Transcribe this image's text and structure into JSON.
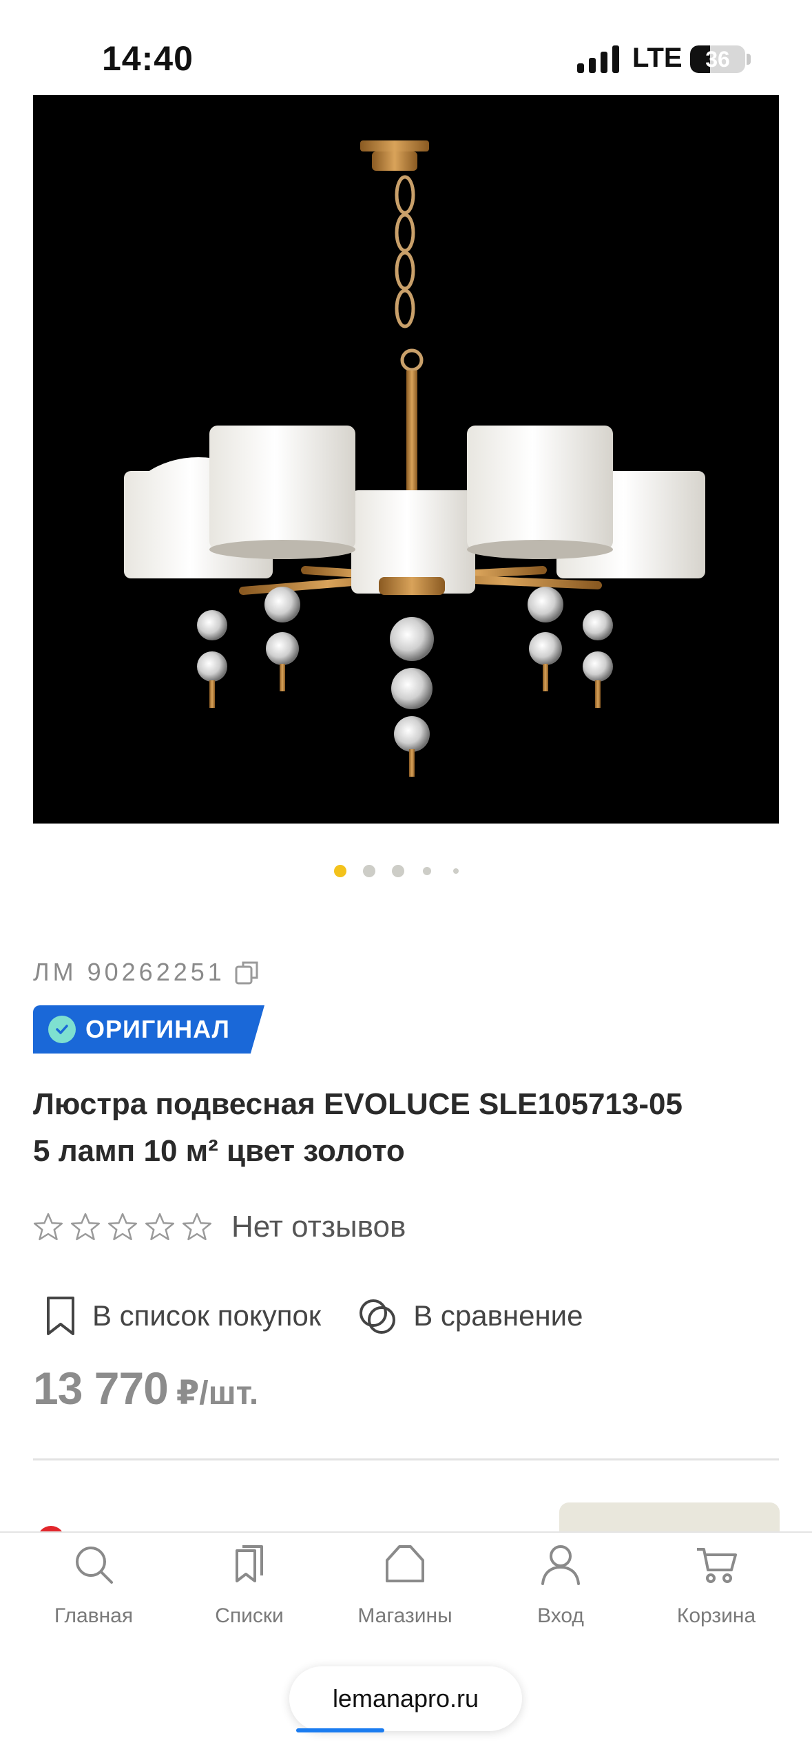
{
  "status_bar": {
    "time": "14:40",
    "network": "LTE",
    "battery": "36",
    "battery_level": 0.36
  },
  "gallery": {
    "image_alt": "Люстра подвесная EVOLUCE SLE105713-05",
    "slide_count": 5,
    "active_slide": 1,
    "active_color": "#f3c21b"
  },
  "product": {
    "sku": "ЛМ 90262251",
    "badge": "ОРИГИНАЛ",
    "title_line1": "Люстра подвесная EVOLUCE SLE105713-05",
    "title_line2": "5 ламп 10 м² цвет золото",
    "rating_stars": 0,
    "reviews": "Нет отзывов",
    "add_to_list": "В список покупок",
    "compare": "В сравнение",
    "price": "13 770",
    "price_unit": "₽/шт."
  },
  "tabbar": {
    "items": [
      {
        "label": "Главная",
        "icon": "search-icon"
      },
      {
        "label": "Списки",
        "icon": "lists-icon"
      },
      {
        "label": "Магазины",
        "icon": "store-icon"
      },
      {
        "label": "Вход",
        "icon": "user-icon"
      },
      {
        "label": "Корзина",
        "icon": "cart-icon"
      }
    ]
  },
  "browser": {
    "url": "lemanapro.ru"
  },
  "colors": {
    "badge": "#1a68d8",
    "badge_check": "#7ee0d0",
    "price": "#8c8c8c",
    "url_progress": "#1a7cf0"
  }
}
